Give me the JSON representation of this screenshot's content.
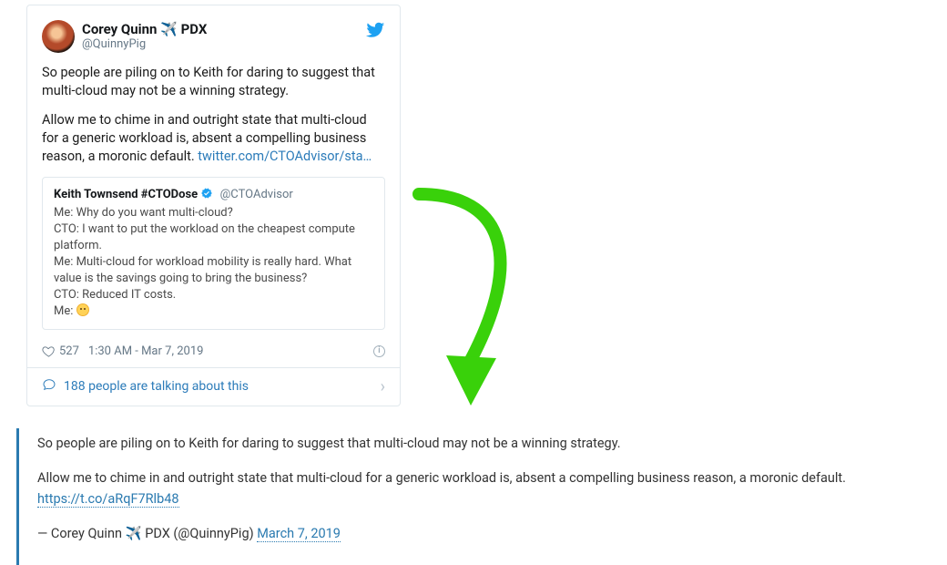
{
  "tweet": {
    "author_name_part1": "Corey Quinn ",
    "author_emoji": "✈️",
    "author_name_part2": " PDX",
    "handle": "@QuinnyPig",
    "body_p1": "So people are piling on to Keith for daring to suggest that multi-cloud may not be a winning strategy.",
    "body_p2_prefix": "Allow me to chime in and outright state that multi-cloud for a generic workload is, absent a compelling business reason, a moronic default. ",
    "body_p2_link": "twitter.com/CTOAdvisor/sta…",
    "quoted": {
      "name": "Keith Townsend #CTODose",
      "handle": "@CTOAdvisor",
      "line1": "Me: Why do you want multi-cloud?",
      "line2": "CTO: I want to put the workload on the cheapest compute platform.",
      "line3": "Me: Multi-cloud for workload mobility is really hard. What value is the savings going to bring the business?",
      "line4": "CTO: Reduced IT costs.",
      "line5": "Me: "
    },
    "likes": "527",
    "timestamp": "1:30 AM - Mar 7, 2019",
    "footer_text": "188 people are talking about this"
  },
  "blockquote": {
    "p1": "So people are piling on to Keith for daring to suggest that multi-cloud may not be a winning strategy.",
    "p2_prefix": "Allow me to chime in and outright state that multi-cloud for a generic workload is, absent a compelling business reason, a moronic default. ",
    "p2_link": "https://t.co/aRqF7Rlb48",
    "attr_prefix": "— Corey Quinn ",
    "attr_mid": " PDX (@QuinnyPig) ",
    "attr_date": "March 7, 2019"
  }
}
